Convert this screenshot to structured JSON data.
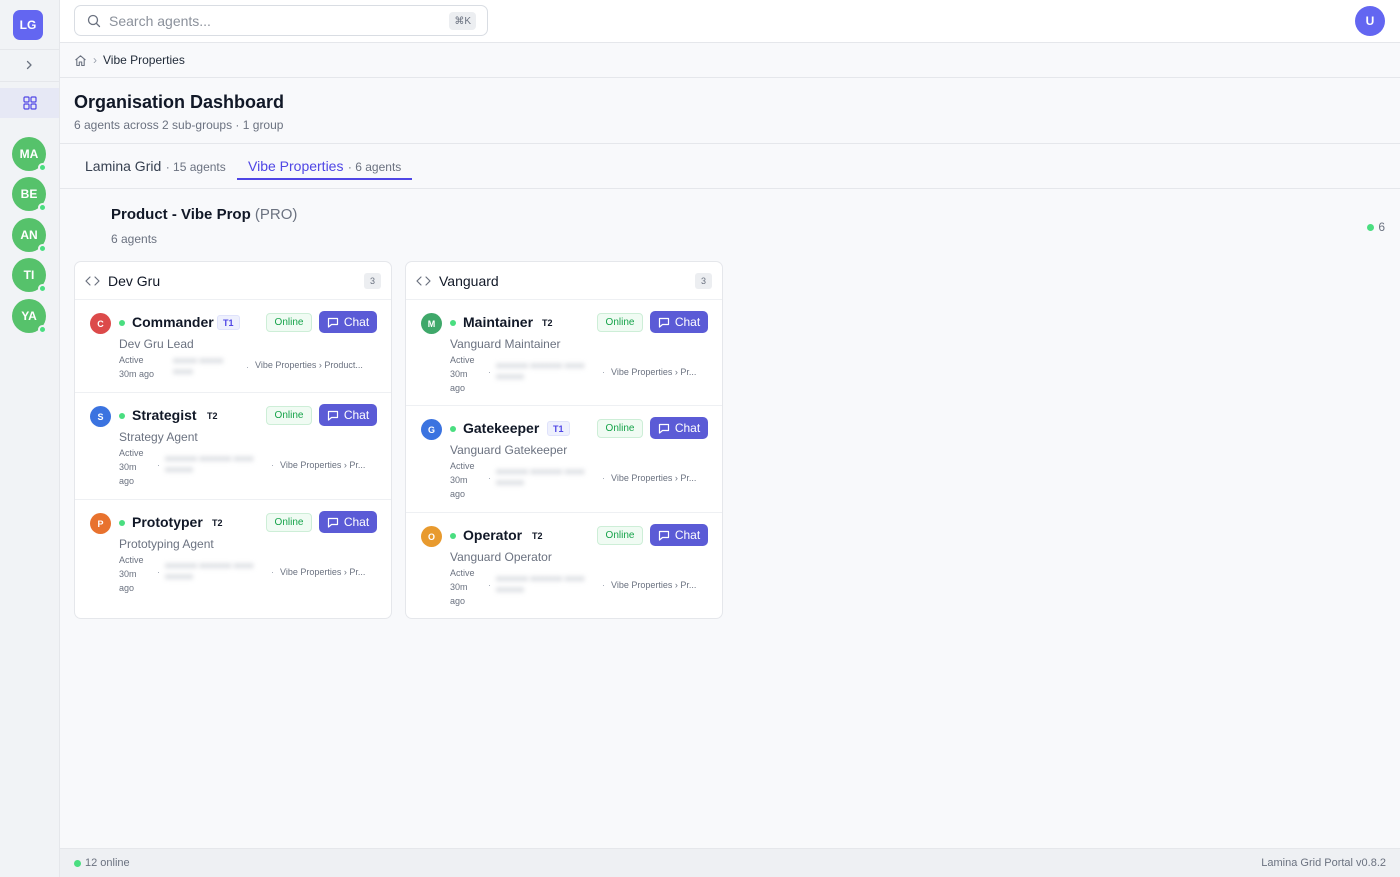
{
  "sidebar": {
    "logo": "LG",
    "avatars": [
      {
        "initials": "MA"
      },
      {
        "initials": "BE"
      },
      {
        "initials": "AN"
      },
      {
        "initials": "TI"
      },
      {
        "initials": "YA"
      }
    ],
    "icons": {
      "expand": "chevron-right-icon",
      "dashboard": "grid-icon"
    }
  },
  "topbar": {
    "search_placeholder": "Search agents...",
    "shortcut": "⌘K",
    "user_initial": "U"
  },
  "breadcrumb": {
    "home_icon": "home-icon",
    "current": "Vibe Properties"
  },
  "header": {
    "title": "Organisation Dashboard",
    "subtitle": "6 agents across 2 sub-groups · 1 group"
  },
  "tabs": [
    {
      "name": "Lamina Grid",
      "count": "· 15 agents"
    },
    {
      "name": "Vibe Properties",
      "count": "· 6 agents"
    }
  ],
  "group": {
    "name": "Product - Vibe Prop",
    "tier": "(PRO)",
    "agent_count": "6 agents",
    "online_count": "6"
  },
  "subgroups": [
    {
      "name": "Dev Gru",
      "count": "3",
      "agents": [
        {
          "initial": "C",
          "name": "Commander",
          "tier": "T1",
          "status": "Online",
          "chat": "Chat",
          "role": "Dev Gru Lead",
          "active": "Active 30m ago",
          "path": "Vibe Properties › Product...",
          "color": "#dc4a4a"
        },
        {
          "initial": "S",
          "name": "Strategist",
          "tier": "T2",
          "status": "Online",
          "chat": "Chat",
          "role": "Strategy Agent",
          "active": "Active 30m ago",
          "path": "Vibe Properties › Pr...",
          "color": "#3b73e0"
        },
        {
          "initial": "P",
          "name": "Prototyper",
          "tier": "T2",
          "status": "Online",
          "chat": "Chat",
          "role": "Prototyping Agent",
          "active": "Active 30m ago",
          "path": "Vibe Properties › Pr...",
          "color": "#e8722e"
        }
      ]
    },
    {
      "name": "Vanguard",
      "count": "3",
      "agents": [
        {
          "initial": "M",
          "name": "Maintainer",
          "tier": "T2",
          "status": "Online",
          "chat": "Chat",
          "role": "Vanguard Maintainer",
          "active": "Active 30m ago",
          "path": "Vibe Properties › Pr...",
          "color": "#3fa86a"
        },
        {
          "initial": "G",
          "name": "Gatekeeper",
          "tier": "T1",
          "status": "Online",
          "chat": "Chat",
          "role": "Vanguard Gatekeeper",
          "active": "Active 30m ago",
          "path": "Vibe Properties › Pr...",
          "color": "#3b73e0"
        },
        {
          "initial": "O",
          "name": "Operator",
          "tier": "T2",
          "status": "Online",
          "chat": "Chat",
          "role": "Vanguard Operator",
          "active": "Active 30m ago",
          "path": "Vibe Properties › Pr...",
          "color": "#e89a2e"
        }
      ]
    }
  ],
  "footer": {
    "online": "12 online",
    "version": "Lamina Grid Portal v0.8.2"
  },
  "colors": {
    "accent": "#5b5bd6",
    "online": "#4ade80",
    "sidebar_avatar": "#56c26b"
  }
}
